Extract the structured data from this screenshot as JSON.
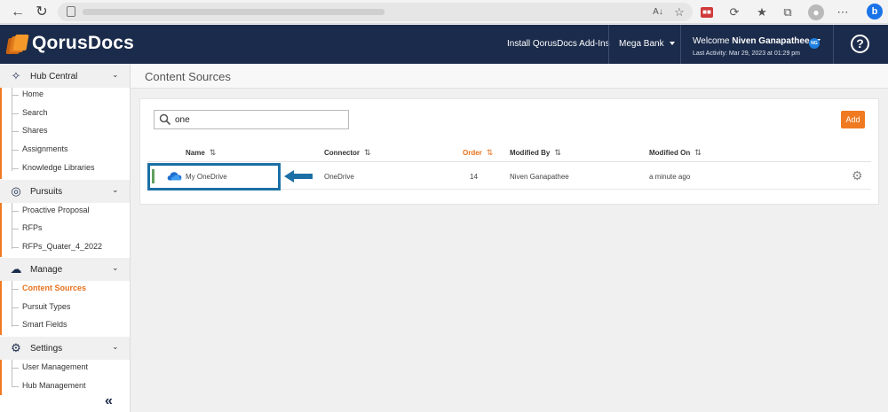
{
  "header": {
    "brand": "QorusDocs",
    "install_label": "Install QorusDocs Add-Ins",
    "org_label": "Mega Bank",
    "welcome_prefix": "Welcome",
    "user_name": "Niven Ganapathee",
    "last_activity": "Last Activity: Mar 29, 2023 at 01:29 pm",
    "avatar_initials": "NG",
    "help_label": "?"
  },
  "sidebar": {
    "sections": [
      {
        "label": "Hub Central",
        "icon": "hub-icon",
        "items": [
          "Home",
          "Search",
          "Shares",
          "Assignments",
          "Knowledge Libraries"
        ]
      },
      {
        "label": "Pursuits",
        "icon": "target-icon",
        "items": [
          "Proactive Proposal",
          "RFPs",
          "RFPs_Quater_4_2022"
        ]
      },
      {
        "label": "Manage",
        "icon": "cloud-users-icon",
        "items": [
          "Content Sources",
          "Pursuit Types",
          "Smart Fields"
        ]
      },
      {
        "label": "Settings",
        "icon": "gear-icon",
        "items": [
          "User Management",
          "Hub Management"
        ]
      }
    ],
    "active_item": "Content Sources",
    "collapse_glyph": "«"
  },
  "main": {
    "page_title": "Content Sources",
    "search_value": "one",
    "add_label": "Add",
    "columns": [
      "Name",
      "Connector",
      "Order",
      "Modified By",
      "Modified On"
    ],
    "sorted_column": "Order",
    "rows": [
      {
        "name": "My OneDrive",
        "connector": "OneDrive",
        "order": "14",
        "modified_by": "Niven Ganapathee",
        "modified_on": "a minute ago"
      }
    ]
  },
  "colors": {
    "brand_navy": "#1b2b4b",
    "accent_orange": "#f07a22",
    "highlight_blue": "#1b6fa5"
  }
}
